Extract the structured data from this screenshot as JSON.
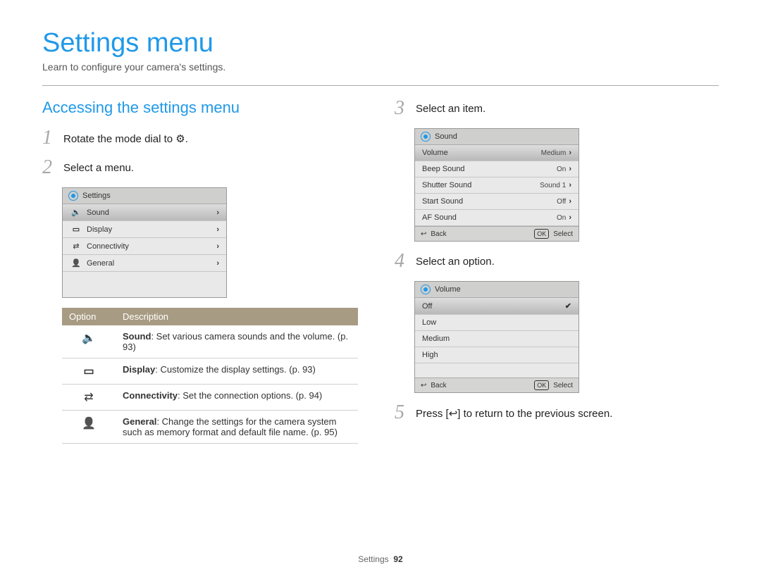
{
  "header": {
    "title": "Settings menu",
    "subtitle": "Learn to configure your camera's settings."
  },
  "section_title": "Accessing the settings menu",
  "steps": {
    "s1": {
      "num": "1",
      "text_before": "Rotate the mode dial to ",
      "text_after": "."
    },
    "s2": {
      "num": "2",
      "text": "Select a menu."
    },
    "s3": {
      "num": "3",
      "text": "Select an item."
    },
    "s4": {
      "num": "4",
      "text": "Select an option."
    },
    "s5": {
      "num": "5",
      "text_before": "Press [",
      "text_after": "] to return to the previous screen."
    }
  },
  "panel_settings": {
    "title": "Settings",
    "rows": [
      {
        "icon": "sound",
        "label": "Sound",
        "selected": true
      },
      {
        "icon": "display",
        "label": "Display"
      },
      {
        "icon": "conn",
        "label": "Connectivity"
      },
      {
        "icon": "user",
        "label": "General"
      }
    ]
  },
  "option_table": {
    "headers": {
      "opt": "Option",
      "desc": "Description"
    },
    "rows": [
      {
        "icon": "sound",
        "title": "Sound",
        "desc": ": Set various camera sounds and the volume. (p. 93)"
      },
      {
        "icon": "display",
        "title": "Display",
        "desc": ": Customize the display settings. (p. 93)"
      },
      {
        "icon": "conn",
        "title": "Connectivity",
        "desc": ": Set the connection options. (p. 94)"
      },
      {
        "icon": "user",
        "title": "General",
        "desc": ": Change the settings for the camera system such as memory format and default file name. (p. 95)"
      }
    ]
  },
  "panel_sound": {
    "title": "Sound",
    "rows": [
      {
        "label": "Volume",
        "value": "Medium",
        "selected": true
      },
      {
        "label": "Beep Sound",
        "value": "On"
      },
      {
        "label": "Shutter Sound",
        "value": "Sound 1"
      },
      {
        "label": "Start Sound",
        "value": "Off"
      },
      {
        "label": "AF Sound",
        "value": "On"
      }
    ],
    "foot_back": "Back",
    "foot_select": "Select"
  },
  "panel_volume": {
    "title": "Volume",
    "rows": [
      {
        "label": "Off",
        "selected": true,
        "checked": true
      },
      {
        "label": "Low"
      },
      {
        "label": "Medium"
      },
      {
        "label": "High"
      }
    ],
    "foot_back": "Back",
    "foot_select": "Select"
  },
  "footer": {
    "label": "Settings",
    "page": "92"
  }
}
